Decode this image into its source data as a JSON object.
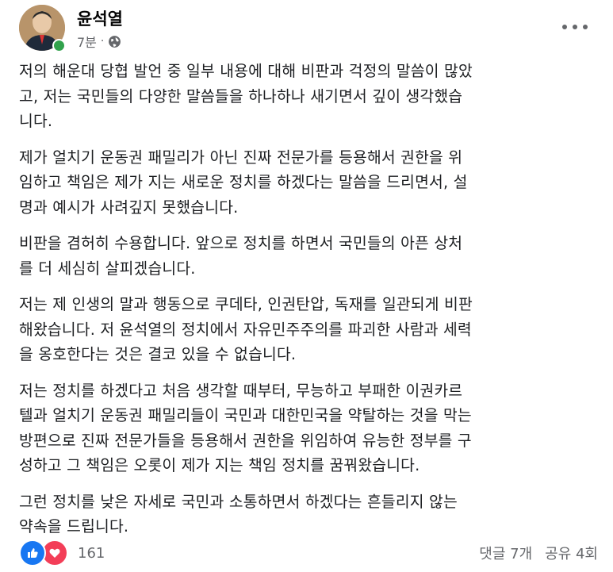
{
  "post": {
    "author": "윤석열",
    "time": "7분",
    "separator": "·",
    "paragraphs": [
      "저의 해운대 당협 발언 중 일부 내용에 대해 비판과 걱정의 말씀이 많았\n고, 저는 국민들의 다양한 말씀들을 하나하나 새기면서 깊이 생각했습\n니다.",
      "제가 얼치기 운동권 패밀리가 아닌 진짜 전문가를 등용해서 권한을 위\n임하고 책임은 제가 지는 새로운 정치를 하겠다는 말씀을 드리면서, 설\n명과 예시가 사려깊지 못했습니다.",
      "비판을 겸허히 수용합니다. 앞으로 정치를 하면서 국민들의 아픈 상처\n를 더 세심히 살피겠습니다.",
      "저는 제 인생의 말과 행동으로 쿠데타, 인권탄압, 독재를 일관되게 비판\n해왔습니다. 저 윤석열의 정치에서 자유민주주의를 파괴한 사람과 세력\n을 옹호한다는 것은 결코 있을 수 없습니다.",
      "저는 정치를 하겠다고 처음 생각할 때부터, 무능하고 부패한 이권카르\n텔과 얼치기 운동권 패밀리들이 국민과 대한민국을 약탈하는 것을 막는\n방편으로 진짜 전문가들을 등용해서 권한을 위임하여 유능한 정부를 구\n성하고 그 책임은 오롯이 제가 지는 책임 정치를 꿈꿔왔습니다.",
      "그런 정치를 낮은 자세로 국민과 소통하면서 하겠다는 흔들리지 않는\n약속을 드립니다."
    ]
  },
  "footer": {
    "reaction_count": "161",
    "comments": "댓글 7개",
    "shares": "공유 4회"
  },
  "icons": {
    "like": "like-icon",
    "love": "love-icon",
    "globe": "globe-icon",
    "more": "more-icon"
  },
  "colors": {
    "like": "#1877f2",
    "love": "#f33e58",
    "online": "#31a24c"
  }
}
